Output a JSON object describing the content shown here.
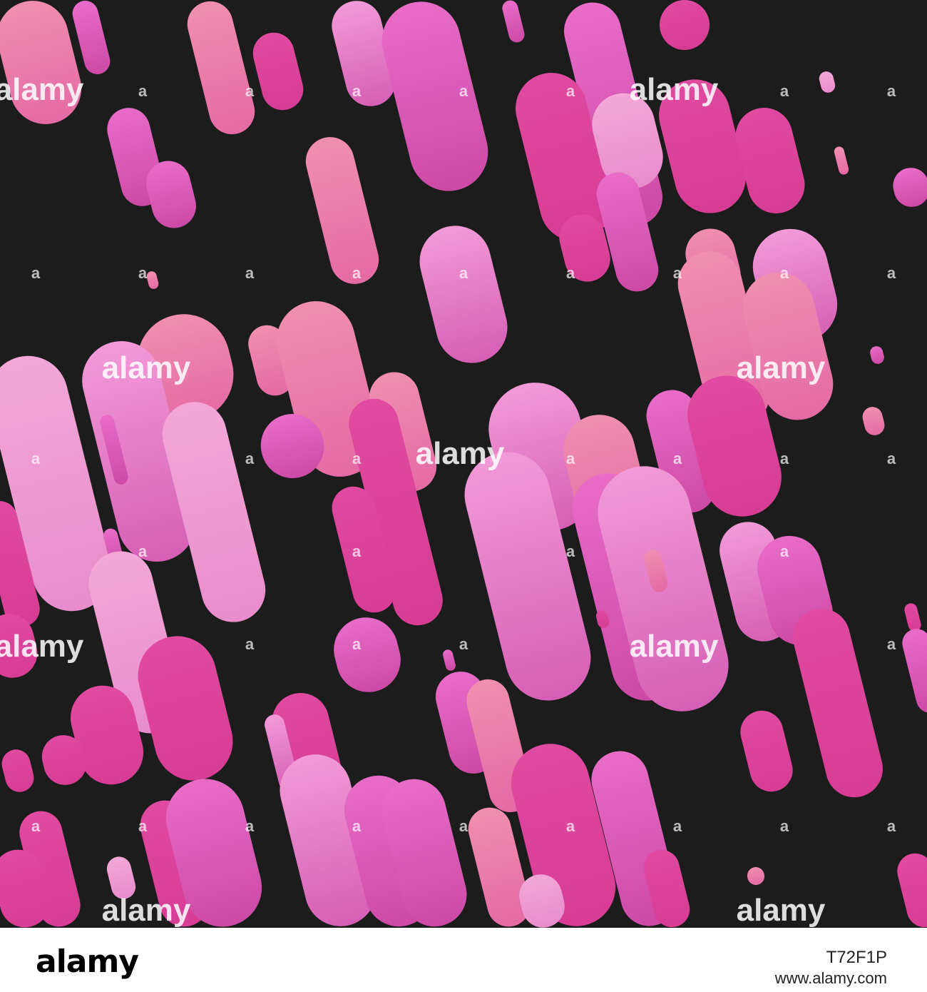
{
  "image": {
    "background_color": "#1c1c1c",
    "palette": [
      "#e05ab4",
      "#ee86d6",
      "#d96ec0",
      "#ea4fa6",
      "#f08fb4",
      "#c84aa8",
      "#f3a6d2",
      "#e0609c",
      "#dc3d98"
    ],
    "shapes_description": "diagonal rounded pill shapes in pink and magenta gradients falling across a dark charcoal background"
  },
  "watermark": {
    "text": "alamy",
    "small_mark": "a",
    "color": "#ffffff"
  },
  "footer": {
    "logo_text": "alamy",
    "image_id": "T72F1P",
    "site": "www.alamy.com"
  }
}
